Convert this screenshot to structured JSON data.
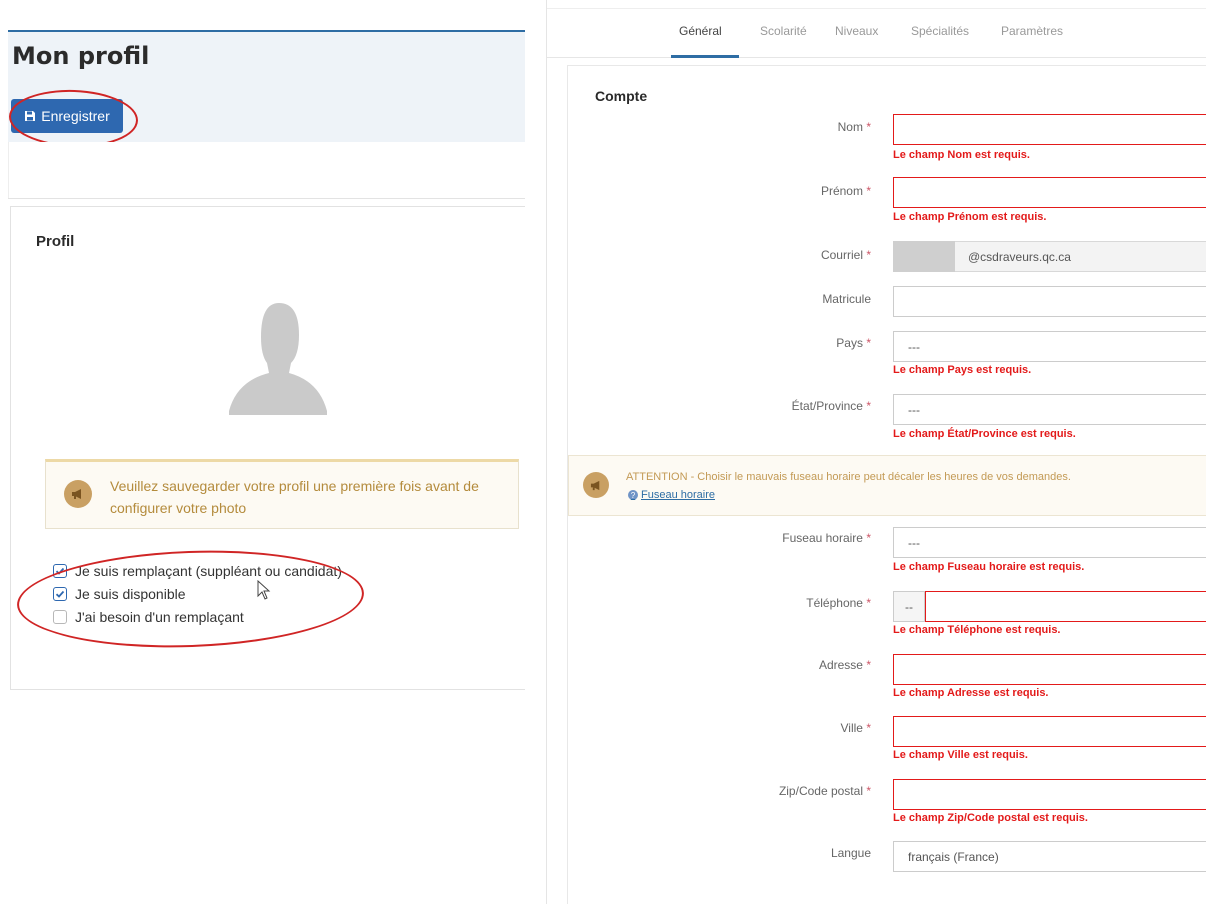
{
  "left": {
    "page_title": "Mon profil",
    "save_label": "Enregistrer",
    "card_title": "Profil",
    "notice_text": "Veuillez sauvegarder votre profil une première fois avant de configurer votre photo",
    "checkboxes": [
      {
        "label": "Je suis remplaçant (suppléant ou candidat)",
        "checked": true
      },
      {
        "label": "Je suis disponible",
        "checked": true
      },
      {
        "label": "J'ai besoin d'un remplaçant",
        "checked": false
      }
    ]
  },
  "tabs": [
    {
      "label": "Général",
      "active": true
    },
    {
      "label": "Scolarité",
      "active": false
    },
    {
      "label": "Niveaux",
      "active": false
    },
    {
      "label": "Spécialités",
      "active": false
    },
    {
      "label": "Paramètres",
      "active": false
    }
  ],
  "form": {
    "section_title": "Compte",
    "nom": {
      "label": "Nom",
      "required": "*",
      "value": "",
      "error": "Le champ Nom est requis."
    },
    "prenom": {
      "label": "Prénom",
      "required": "*",
      "value": "",
      "error": "Le champ Prénom est requis."
    },
    "courriel": {
      "label": "Courriel",
      "required": "*",
      "value": "@csdraveurs.qc.ca"
    },
    "matricule": {
      "label": "Matricule",
      "value": ""
    },
    "pays": {
      "label": "Pays",
      "required": "*",
      "value": "---",
      "error": "Le champ Pays est requis."
    },
    "province": {
      "label": "État/Province",
      "required": "*",
      "value": "---",
      "error": "Le champ État/Province est requis."
    },
    "warning_text": "ATTENTION - Choisir le mauvais fuseau horaire peut décaler les heures de vos demandes.",
    "warning_link": "Fuseau horaire",
    "fuseau": {
      "label": "Fuseau horaire",
      "required": "*",
      "value": "---",
      "error": "Le champ Fuseau horaire est requis."
    },
    "telephone": {
      "label": "Téléphone",
      "required": "*",
      "prefix": "--",
      "value": "",
      "error": "Le champ Téléphone est requis."
    },
    "adresse": {
      "label": "Adresse",
      "required": "*",
      "value": "",
      "error": "Le champ Adresse est requis."
    },
    "ville": {
      "label": "Ville",
      "required": "*",
      "value": "",
      "error": "Le champ Ville est requis."
    },
    "zip": {
      "label": "Zip/Code postal",
      "required": "*",
      "value": "",
      "error": "Le champ Zip/Code postal est requis."
    },
    "langue": {
      "label": "Langue",
      "value": "français (France)"
    }
  },
  "colors": {
    "primary": "#2e68b0",
    "error": "#e31a1a",
    "warning_text": "#b48b3c",
    "annotation": "#d02525"
  }
}
